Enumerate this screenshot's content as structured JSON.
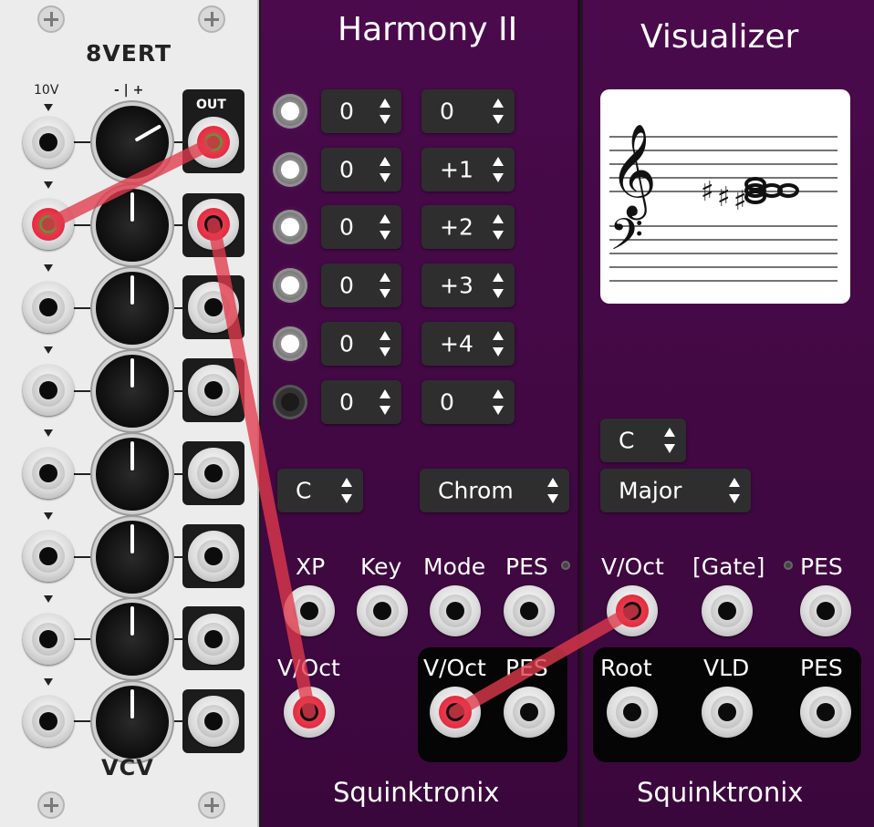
{
  "vert": {
    "title": "8VERT",
    "label_10v": "10V",
    "label_range": "- | +",
    "label_out": "OUT",
    "brand": "VCV",
    "rows": 8
  },
  "harmony": {
    "title": "Harmony II",
    "brand": "Squinktronix",
    "rows": [
      {
        "led": "on",
        "a": "0",
        "b": "0"
      },
      {
        "led": "on",
        "a": "0",
        "b": "+1"
      },
      {
        "led": "on",
        "a": "0",
        "b": "+2"
      },
      {
        "led": "on",
        "a": "0",
        "b": "+3"
      },
      {
        "led": "on",
        "a": "0",
        "b": "+4"
      },
      {
        "led": "off",
        "a": "0",
        "b": "0"
      }
    ],
    "key_select": "C",
    "mode_select": "Chrom",
    "labels": {
      "xp": "XP",
      "key": "Key",
      "mode": "Mode",
      "pes": "PES",
      "voct_in": "V/Oct",
      "voct_out": "V/Oct",
      "pes_out": "PES"
    }
  },
  "visualizer": {
    "title": "Visualizer",
    "brand": "Squinktronix",
    "key_select": "C",
    "mode_select": "Major",
    "labels": {
      "voct": "V/Oct",
      "gate": "[Gate]",
      "pes": "PES",
      "root": "Root",
      "vld": "VLD",
      "pes_out": "PES"
    }
  },
  "colors": {
    "cable_red": "#e23a4c",
    "panel_purple": "#4a0a4c",
    "vert_bg": "#ececec"
  }
}
